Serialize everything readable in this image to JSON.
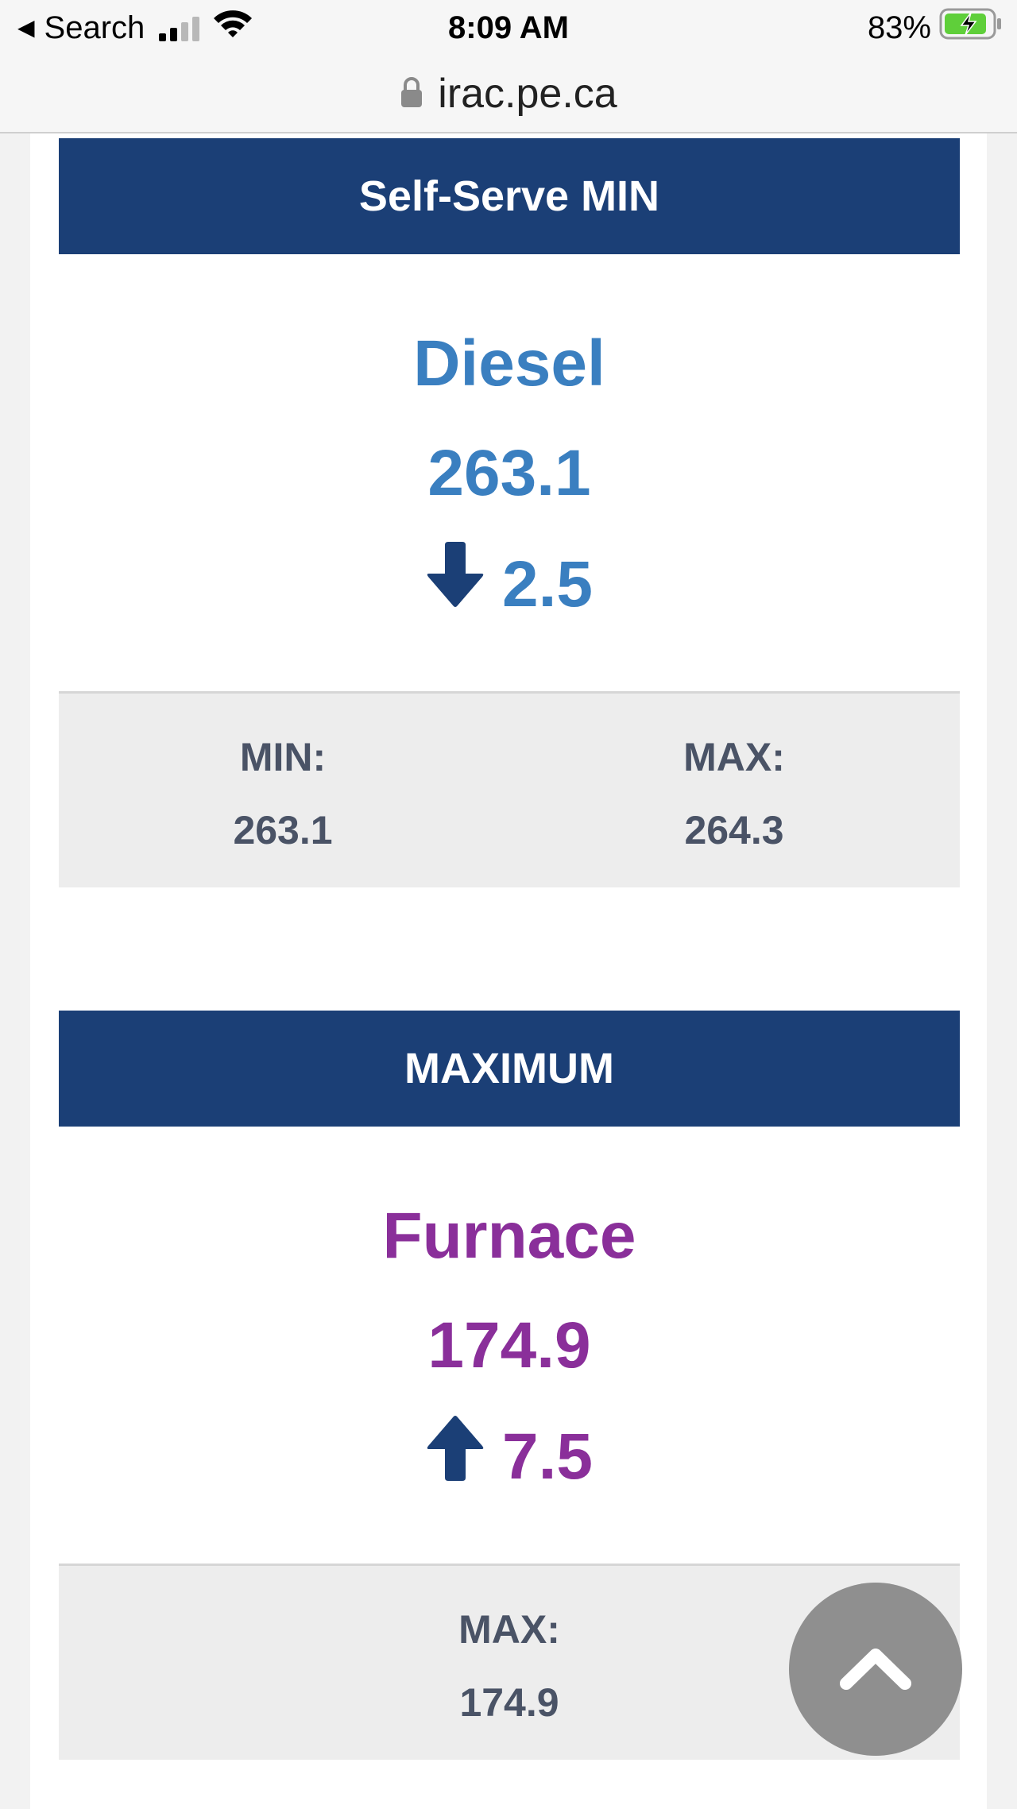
{
  "status_bar": {
    "back_label": "Search",
    "time": "8:09 AM",
    "battery_percent": "83%",
    "icons": [
      "back-triangle-icon",
      "signal-icon",
      "wifi-icon",
      "battery-charging-icon"
    ]
  },
  "url_bar": {
    "url": "irac.pe.ca",
    "icon": "lock-icon"
  },
  "cards": [
    {
      "header": "Self-Serve MIN",
      "fuel": "Diesel",
      "price": "263.1",
      "change_direction": "down",
      "change_value": "2.5",
      "color": "#3a7fc0",
      "stats": [
        {
          "label": "MIN:",
          "value": "263.1"
        },
        {
          "label": "MAX:",
          "value": "264.3"
        }
      ]
    },
    {
      "header": "MAXIMUM",
      "fuel": "Furnace",
      "price": "174.9",
      "change_direction": "up",
      "change_value": "7.5",
      "color": "#8a2f9a",
      "stats": [
        {
          "label": "MAX:",
          "value": "174.9"
        }
      ]
    }
  ],
  "colors": {
    "header_bg": "#1b3f76",
    "arrow": "#1b3f76",
    "stats_text": "#4a5366",
    "stats_bg": "#ededed",
    "battery_green": "#5fcf3a"
  },
  "scroll_top": {
    "icon": "chevron-up-icon"
  }
}
